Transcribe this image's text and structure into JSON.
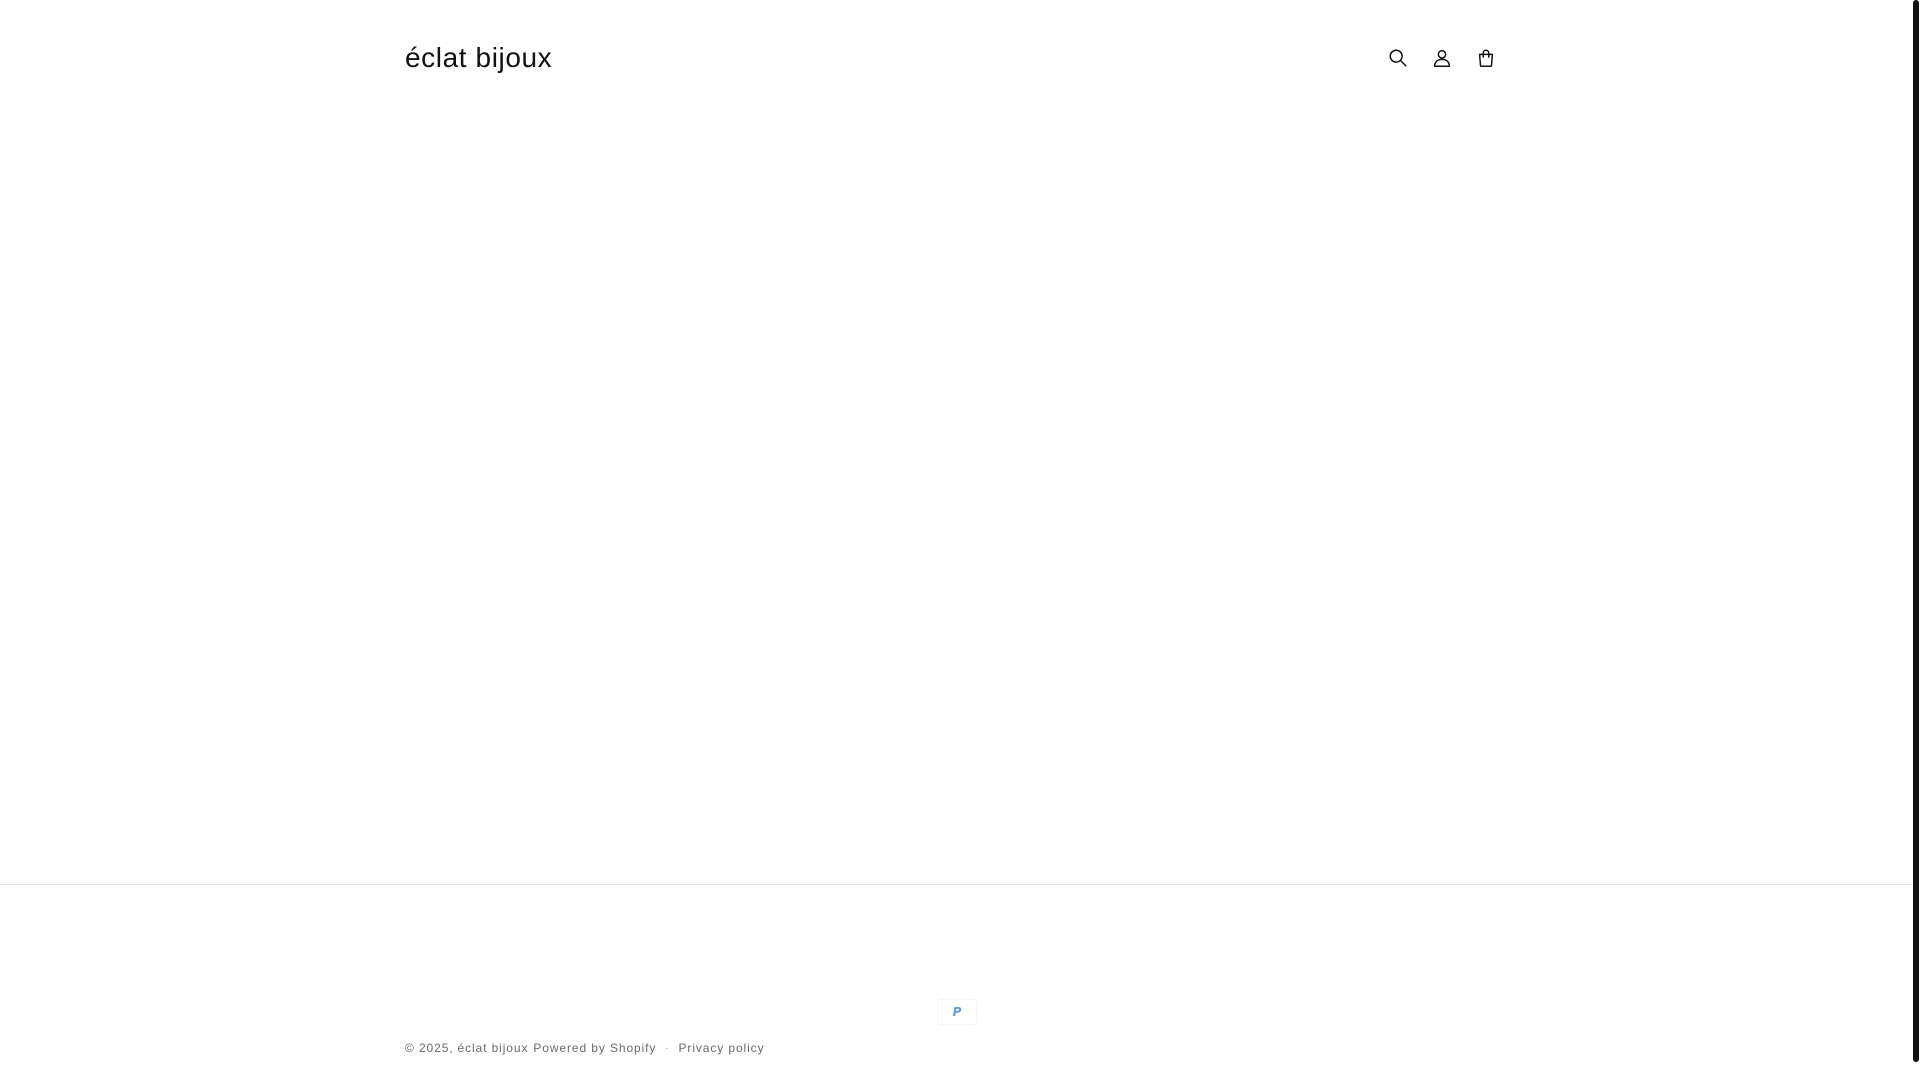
{
  "header": {
    "logo_text": "éclat bijoux",
    "icons": [
      "search-icon",
      "account-icon",
      "cart-icon"
    ]
  },
  "footer": {
    "payment_icons": [
      {
        "name": "paypal-icon",
        "label": "P"
      }
    ],
    "copyright_prefix": "© 2025,",
    "store_link": "éclat bijoux",
    "powered_by": "Powered by Shopify",
    "separator": "·",
    "privacy_policy": "Privacy policy"
  },
  "colors": {
    "text": "#121212",
    "muted": "#6b6b6b",
    "divider": "#e6e6e6",
    "paypal": "#2a6ecf"
  }
}
